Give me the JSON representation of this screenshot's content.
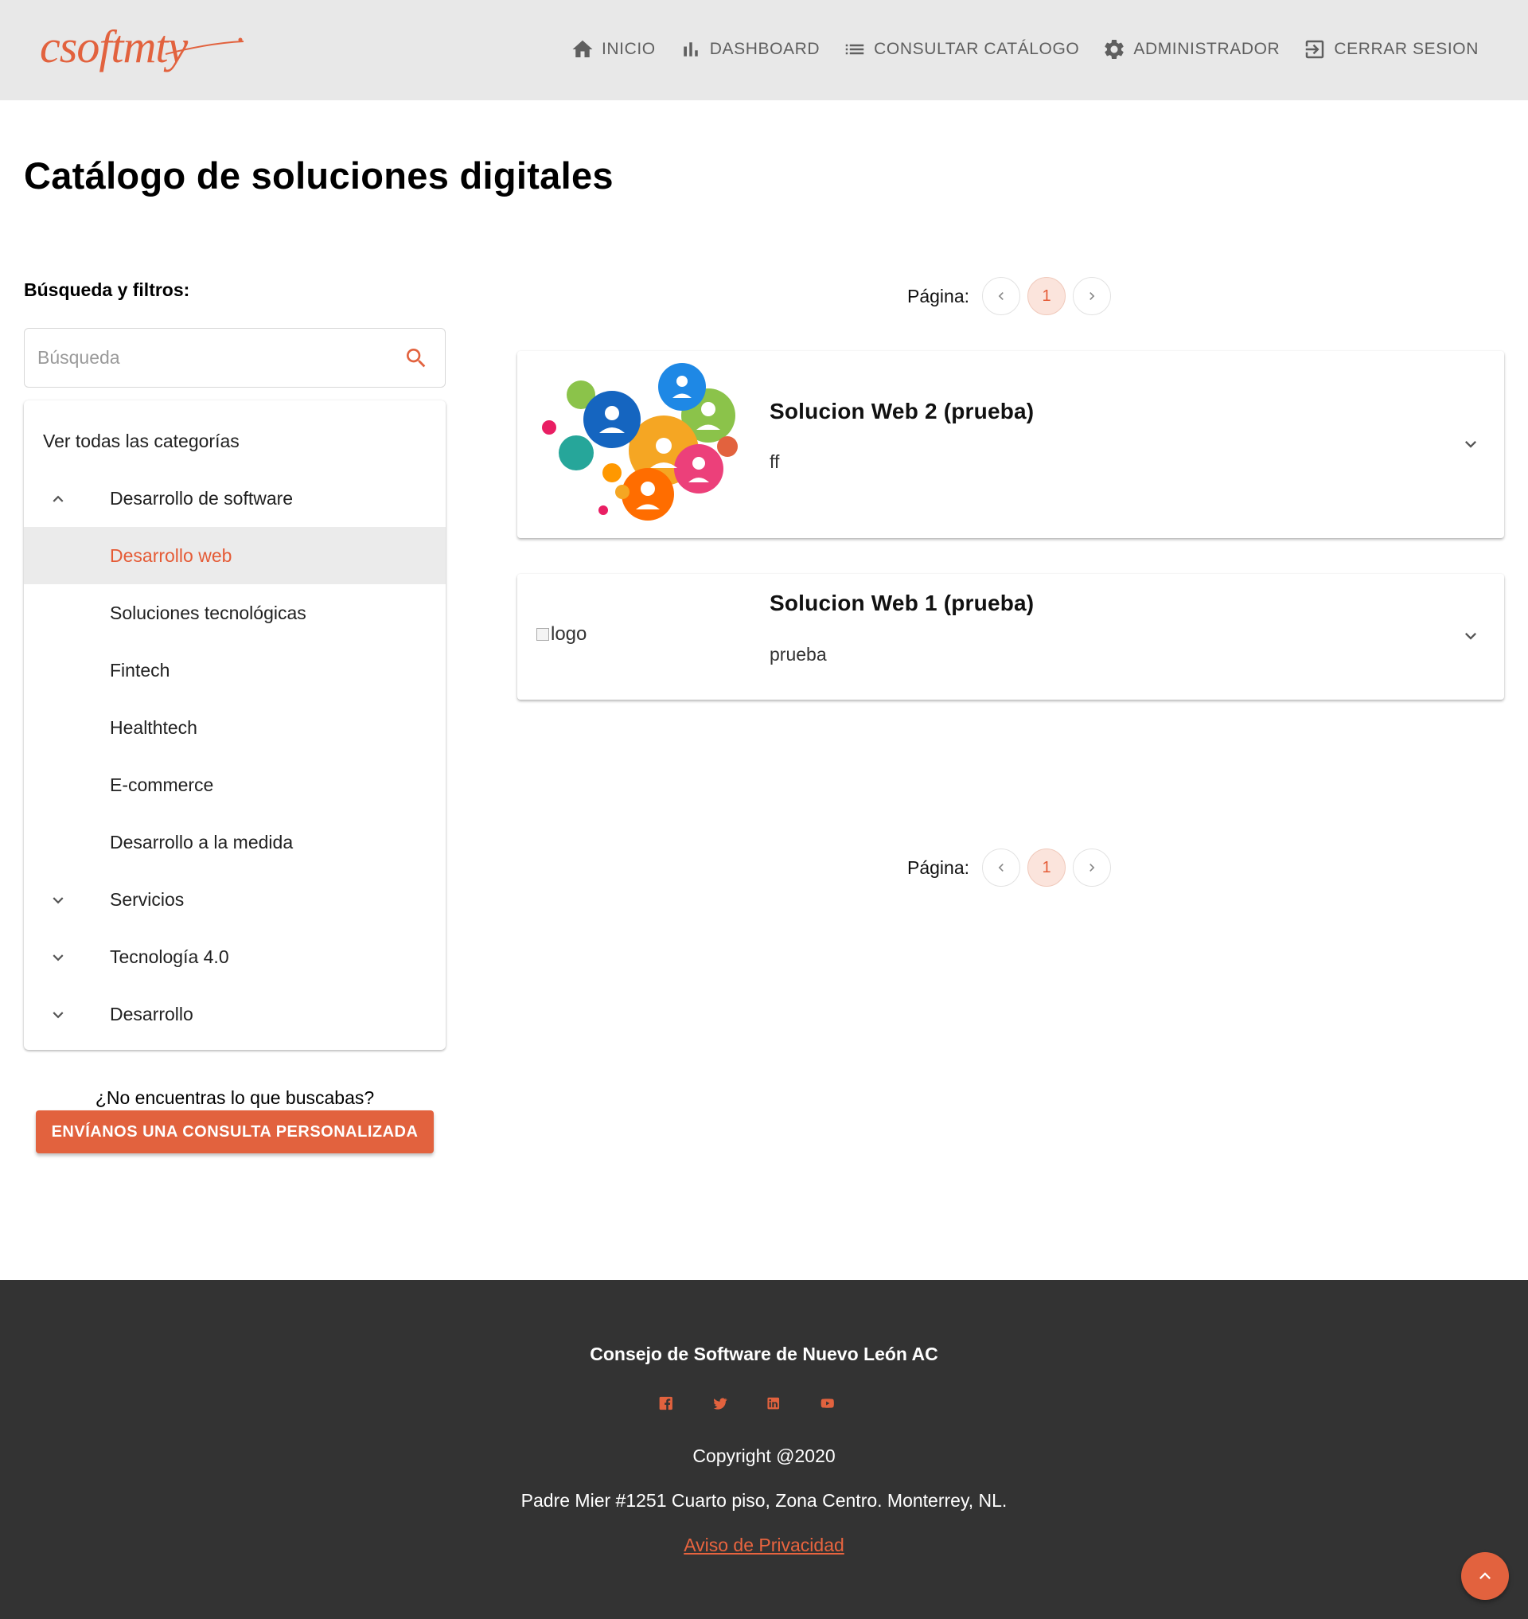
{
  "brand": {
    "logo_text": "csoftmty",
    "accent_color": "#e2623e"
  },
  "nav": {
    "items": [
      {
        "label": "INICIO",
        "icon": "home-icon"
      },
      {
        "label": "DASHBOARD",
        "icon": "bar-chart-icon"
      },
      {
        "label": "CONSULTAR CATÁLOGO",
        "icon": "list-icon"
      },
      {
        "label": "ADMINISTRADOR",
        "icon": "gear-icon"
      },
      {
        "label": "CERRAR SESION",
        "icon": "logout-icon"
      }
    ]
  },
  "page": {
    "title": "Catálogo de soluciones digitales"
  },
  "sidebar": {
    "filters_label": "Búsqueda y filtros:",
    "search": {
      "placeholder": "Búsqueda",
      "value": ""
    },
    "categories": {
      "all_label": "Ver todas las categorías",
      "groups": [
        {
          "label": "Desarrollo de software",
          "expanded": true
        },
        {
          "label": "Servicios",
          "expanded": false
        },
        {
          "label": "Tecnología 4.0",
          "expanded": false
        },
        {
          "label": "Desarrollo",
          "expanded": false
        }
      ],
      "subitems": [
        {
          "label": "Desarrollo web",
          "selected": true
        },
        {
          "label": "Soluciones tecnológicas",
          "selected": false
        },
        {
          "label": "Fintech",
          "selected": false
        },
        {
          "label": "Healthtech",
          "selected": false
        },
        {
          "label": "E-commerce",
          "selected": false
        },
        {
          "label": "Desarrollo a la medida",
          "selected": false
        }
      ]
    },
    "not_found_text": "¿No encuentras lo que buscabas?",
    "consult_button": "ENVÍANOS UNA CONSULTA PERSONALIZADA"
  },
  "pagination": {
    "label": "Página:",
    "current_page": "1"
  },
  "results": [
    {
      "title": "Solucion Web 2 (prueba)",
      "description": "ff",
      "image": "people-network-illustration"
    },
    {
      "title": "Solucion Web 1 (prueba)",
      "description": "prueba",
      "image_alt": "logo"
    }
  ],
  "footer": {
    "organization": "Consejo de Software de Nuevo León AC",
    "socials": [
      "facebook-icon",
      "twitter-icon",
      "linkedin-icon",
      "youtube-icon"
    ],
    "copyright": "Copyright @2020",
    "address": "Padre Mier #1251 Cuarto piso, Zona Centro. Monterrey, NL.",
    "privacy_link": "Aviso de Privacidad"
  }
}
